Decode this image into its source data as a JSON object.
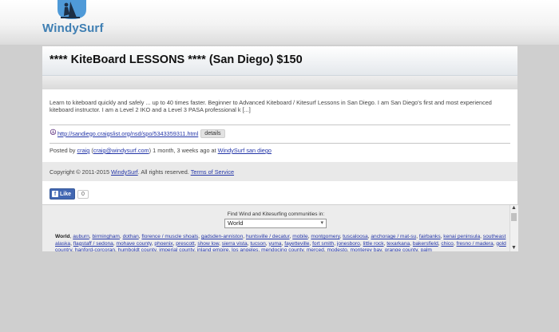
{
  "header": {
    "logo_text": "WindySurf"
  },
  "listing": {
    "title": "**** KiteBoard LESSONS **** (San Diego) $150",
    "description": "Learn to kiteboard quickly and safely ... up to 40 times faster. Beginner to Advanced Kiteboard / Kitesurf Lessons in San Diego. I am San Diego's first and most experienced kiteboard instructor. I am a Level 2 IKO and a Level 3 PASA professional k [...]",
    "source_link": "http://sandiego.craigslist.org/nsd/spo/5343359311.html",
    "details_label": "details",
    "posted_prefix": "Posted by",
    "poster_name": "craig",
    "poster_email": "craig@windysurf.com",
    "posted_time": "1 month, 3 weeks ago at",
    "posted_location": "WindySurf san diego"
  },
  "footer": {
    "copyright_prefix": "Copyright © 2011-2015",
    "copyright_site": "WindySurf",
    "copyright_suffix": ". All rights reserved.",
    "terms_label": "Terms of Service"
  },
  "social": {
    "like_label": "Like",
    "like_count": "0",
    "icon": "facebook-icon"
  },
  "community": {
    "find_label": "Find Wind and Kitesurfing communities in:",
    "selected_region": "World",
    "list_heading": "World",
    "places": [
      "auburn",
      "birmingham",
      "dothan",
      "florence / muscle shoals",
      "gadsden-anniston",
      "huntsville / decatur",
      "mobile",
      "montgomery",
      "tuscaloosa",
      "anchorage / mat-su",
      "fairbanks",
      "kenai peninsula",
      "southeast alaska",
      "flagstaff / sedona",
      "mohave county",
      "phoenix",
      "prescott",
      "show low",
      "sierra vista",
      "tucson",
      "yuma",
      "fayetteville",
      "fort smith",
      "jonesboro",
      "little rock",
      "texarkana",
      "bakersfield",
      "chico",
      "fresno / madera",
      "gold country",
      "hanford-corcoran",
      "humboldt county",
      "imperial county",
      "inland empire",
      "los angeles",
      "mendocino county",
      "merced",
      "modesto",
      "monterey bay",
      "orange county",
      "palm"
    ]
  }
}
